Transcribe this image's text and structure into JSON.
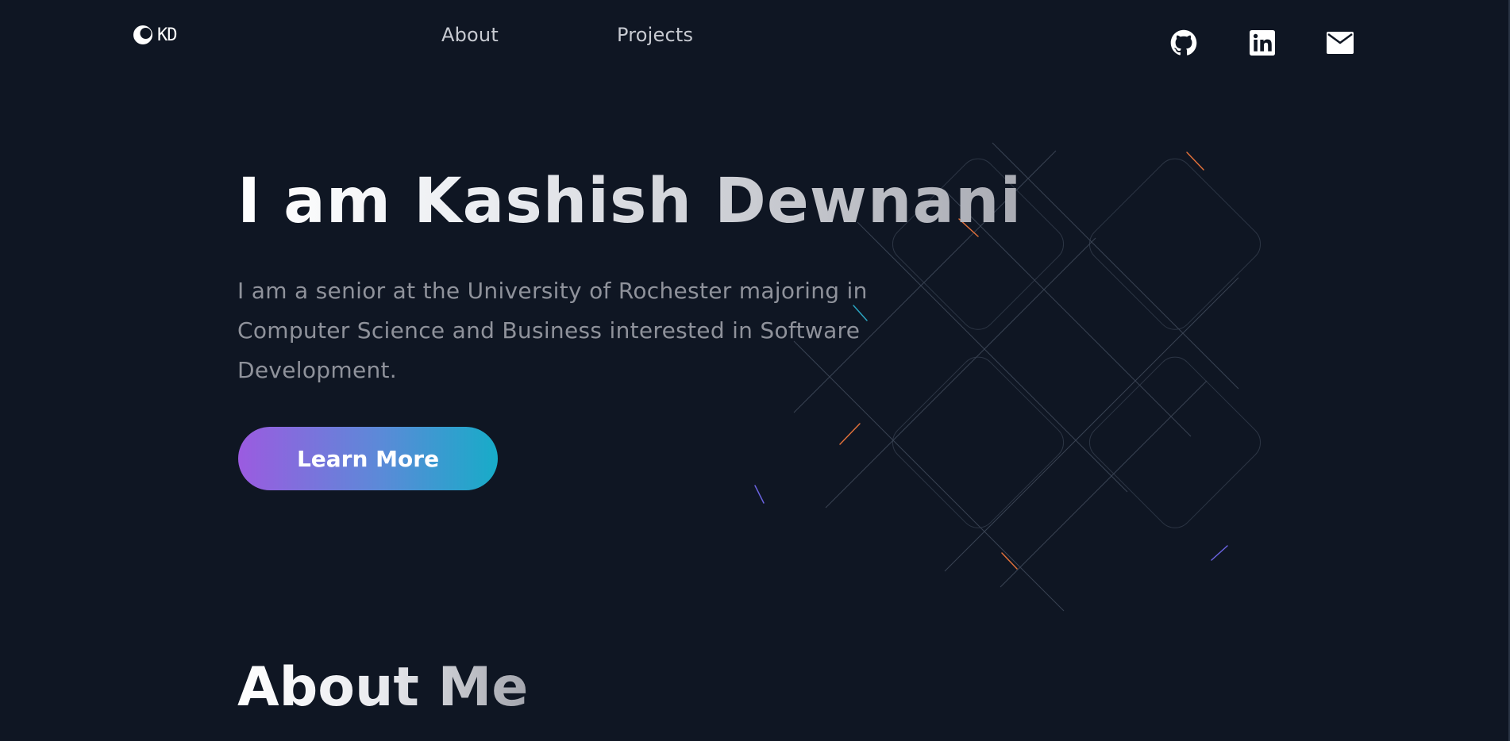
{
  "nav": {
    "logo_text": "KD",
    "links": [
      {
        "label": "About"
      },
      {
        "label": "Projects"
      }
    ],
    "social": [
      {
        "icon": "github-icon"
      },
      {
        "icon": "linkedin-icon"
      },
      {
        "icon": "mail-icon"
      }
    ]
  },
  "hero": {
    "title": "I am Kashish Dewnani",
    "description": "I am a senior at the University of Rochester majoring in Computer Science and Business interested in Software Development.",
    "cta_label": "Learn More"
  },
  "about": {
    "title": "About Me"
  },
  "colors": {
    "background": "#0f1623",
    "accent_start": "#9b5be0",
    "accent_end": "#17acc8",
    "text_muted": "#8f929b"
  }
}
